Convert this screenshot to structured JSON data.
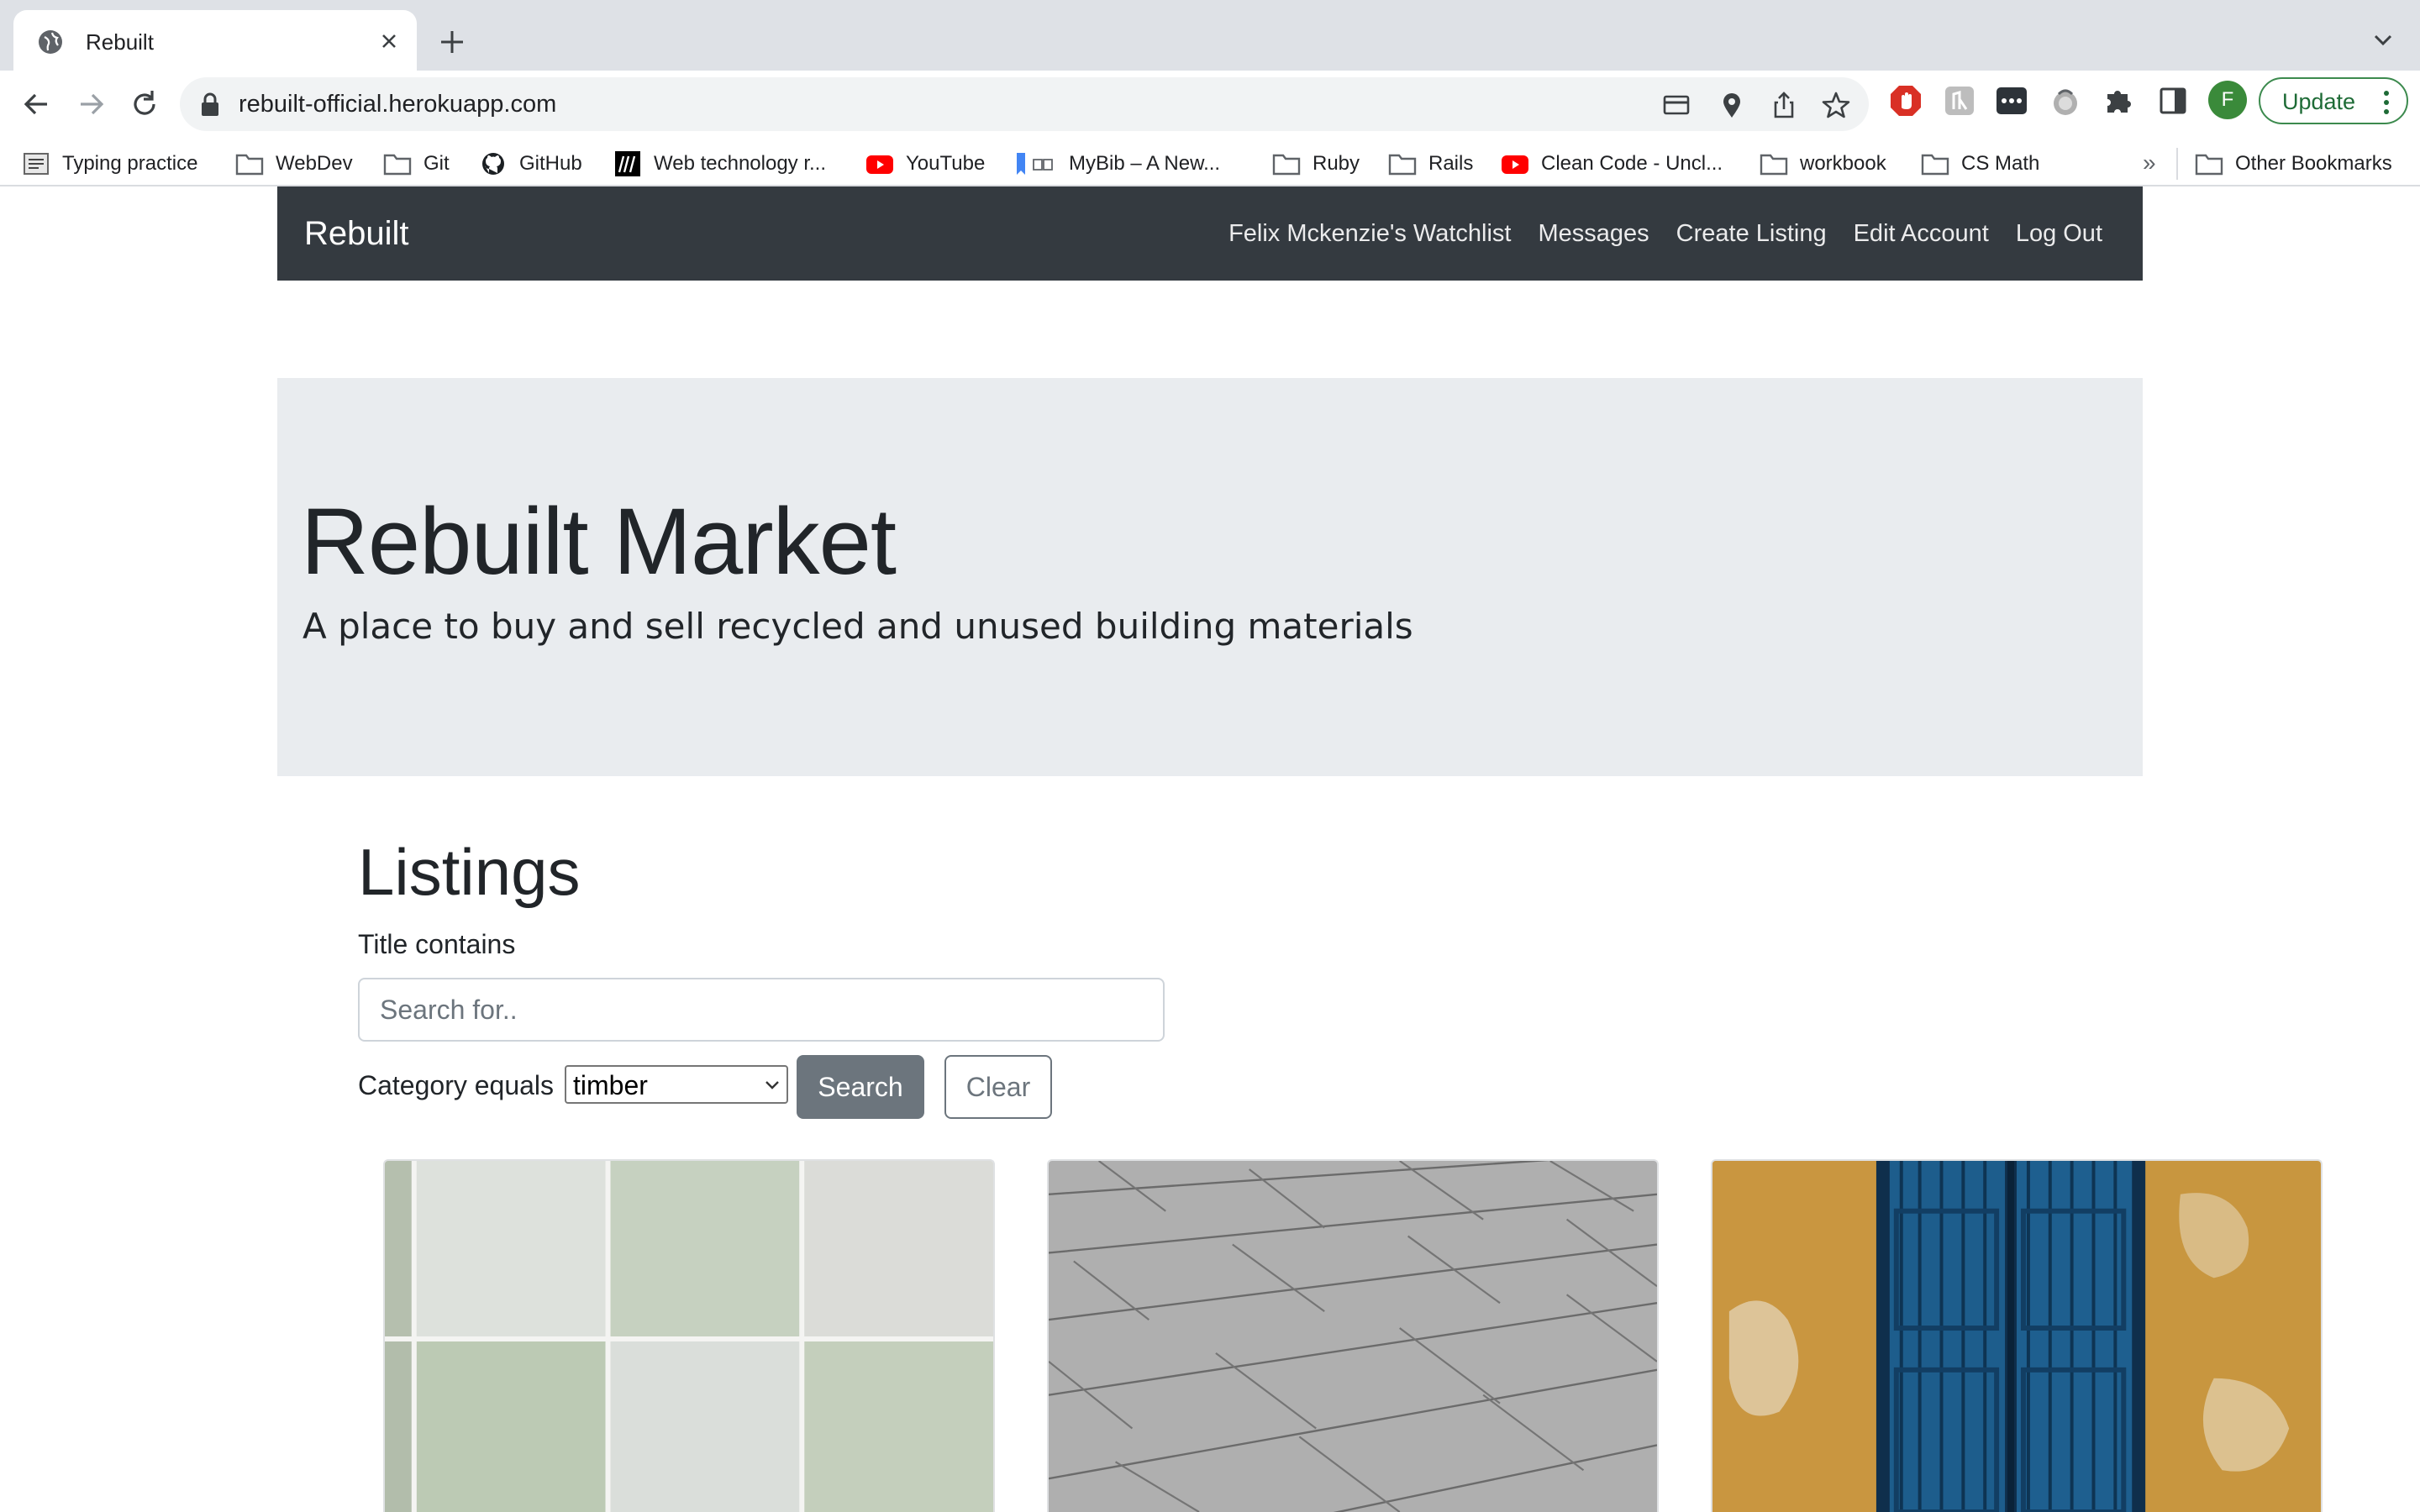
{
  "browser": {
    "tab_title": "Rebuilt",
    "url": "rebuilt-official.herokuapp.com",
    "profile_initial": "F",
    "update_label": "Update",
    "bookmarks": [
      {
        "label": "Typing practice",
        "icon": "typing-icon"
      },
      {
        "label": "WebDev",
        "icon": "folder-icon"
      },
      {
        "label": "Git",
        "icon": "folder-icon"
      },
      {
        "label": "GitHub",
        "icon": "github-icon"
      },
      {
        "label": "Web technology r...",
        "icon": "mdn-icon"
      },
      {
        "label": "YouTube",
        "icon": "youtube-icon"
      },
      {
        "label": "MyBib – A New...",
        "icon": "bookmark-icon"
      },
      {
        "label": "Ruby",
        "icon": "folder-icon"
      },
      {
        "label": "Rails",
        "icon": "folder-icon"
      },
      {
        "label": "Clean Code - Uncl...",
        "icon": "youtube-icon"
      },
      {
        "label": "workbook",
        "icon": "folder-icon"
      },
      {
        "label": "CS Math",
        "icon": "folder-icon"
      }
    ],
    "bookmarks_overflow": "»",
    "other_bookmarks": "Other Bookmarks"
  },
  "site": {
    "brand": "Rebuilt",
    "nav": {
      "watchlist": "Felix Mckenzie's Watchlist",
      "messages": "Messages",
      "create_listing": "Create Listing",
      "edit_account": "Edit Account",
      "log_out": "Log Out"
    },
    "hero": {
      "title": "Rebuilt Market",
      "subtitle": "A place to buy and sell recycled and unused building materials"
    },
    "listings": {
      "heading": "Listings",
      "title_filter_label": "Title contains",
      "search_placeholder": "Search for..",
      "category_label": "Category equals",
      "category_selected": "timber",
      "search_button": "Search",
      "clear_button": "Clear"
    }
  },
  "colors": {
    "navbar": "#343a40",
    "jumbotron": "#e9ecef",
    "secondary": "#6c757d",
    "update_green": "#1e6b36"
  }
}
